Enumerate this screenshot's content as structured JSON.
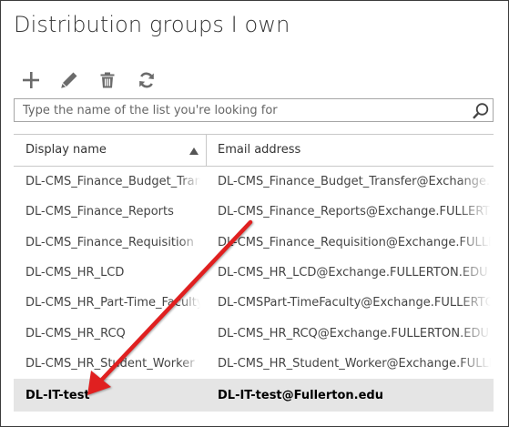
{
  "page": {
    "title": "Distribution groups I own"
  },
  "toolbar": {
    "buttons": [
      {
        "name": "add",
        "icon": "plus-icon"
      },
      {
        "name": "edit",
        "icon": "pencil-icon"
      },
      {
        "name": "delete",
        "icon": "trash-icon"
      },
      {
        "name": "refresh",
        "icon": "refresh-icon"
      }
    ]
  },
  "search": {
    "placeholder": "Type the name of the list you're looking for",
    "value": "",
    "icon": "search-icon"
  },
  "table": {
    "columns": [
      {
        "label": "Display name",
        "sort": "ascending"
      },
      {
        "label": "Email address"
      }
    ],
    "rows": [
      {
        "name": "DL-CMS_Finance_Budget_Transfer",
        "email": "DL-CMS_Finance_Budget_Transfer@Exchange.FULLERTON.EDU"
      },
      {
        "name": "DL-CMS_Finance_Reports",
        "email": "DL-CMS_Finance_Reports@Exchange.FULLERTON.EDU"
      },
      {
        "name": "DL-CMS_Finance_Requisition",
        "email": "DL-CMS_Finance_Requisition@Exchange.FULLERTON.EDU"
      },
      {
        "name": "DL-CMS_HR_LCD",
        "email": "DL-CMS_HR_LCD@Exchange.FULLERTON.EDU"
      },
      {
        "name": "DL-CMS_HR_Part-Time_Faculty",
        "email": "DL-CMSPart-TimeFaculty@Exchange.FULLERTON.EDU"
      },
      {
        "name": "DL-CMS_HR_RCQ",
        "email": "DL-CMS_HR_RCQ@Exchange.FULLERTON.EDU"
      },
      {
        "name": "DL-CMS_HR_Student_Worker",
        "email": "DL-CMS_HR_Student_Worker@Exchange.FULLERTON.EDU"
      },
      {
        "name": "DL-IT-test",
        "email": "DL-IT-test@Fullerton.edu",
        "selected": true
      }
    ]
  },
  "annotation": {
    "type": "arrow",
    "color": "#e02020",
    "points_to": "DL-IT-test"
  },
  "colors": {
    "icon": "#6b6b6b",
    "selected_row": "#e5e5e5",
    "border": "#c8c8c8",
    "arrow": "#e02020"
  }
}
